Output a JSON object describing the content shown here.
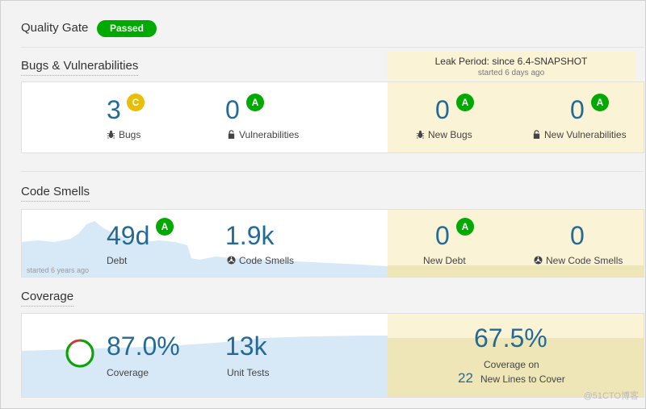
{
  "quality_gate": {
    "title": "Quality Gate",
    "status": "Passed"
  },
  "leak_period": {
    "title": "Leak Period: since 6.4-SNAPSHOT",
    "subtitle": "started 6 days ago"
  },
  "bugs_section": {
    "title": "Bugs & Vulnerabilities",
    "bugs": {
      "value": "3",
      "rating": "C",
      "label": "Bugs",
      "icon": "bug-icon"
    },
    "vulnerabilities": {
      "value": "0",
      "rating": "A",
      "label": "Vulnerabilities",
      "icon": "lock-icon"
    },
    "new_bugs": {
      "value": "0",
      "rating": "A",
      "label": "New Bugs",
      "icon": "bug-icon"
    },
    "new_vulnerabilities": {
      "value": "0",
      "rating": "A",
      "label": "New Vulnerabilities",
      "icon": "lock-icon"
    }
  },
  "code_smells_section": {
    "title": "Code Smells",
    "started": "started 6 years ago",
    "debt": {
      "value": "49d",
      "rating": "A",
      "label": "Debt"
    },
    "code_smells": {
      "value": "1.9k",
      "label": "Code Smells",
      "icon": "smell-icon"
    },
    "new_debt": {
      "value": "0",
      "rating": "A",
      "label": "New Debt"
    },
    "new_code_smells": {
      "value": "0",
      "label": "New Code Smells",
      "icon": "smell-icon"
    }
  },
  "coverage_section": {
    "title": "Coverage",
    "coverage": {
      "value": "87.0%",
      "label": "Coverage",
      "donut_fraction": 0.87
    },
    "unit_tests": {
      "value": "13k",
      "label": "Unit Tests"
    },
    "new_coverage": {
      "value": "67.5%",
      "label_line1": "Coverage on",
      "new_lines": "22",
      "label_line2": "New Lines to Cover"
    }
  },
  "watermark": "@51CTO博客",
  "colors": {
    "passed": "#00aa00",
    "rating_a": "#00aa00",
    "rating_c": "#eabe06",
    "metric_blue": "#236a97",
    "leak_bg": "#fbf3d5",
    "chart_fill": "#d7e9f7"
  }
}
